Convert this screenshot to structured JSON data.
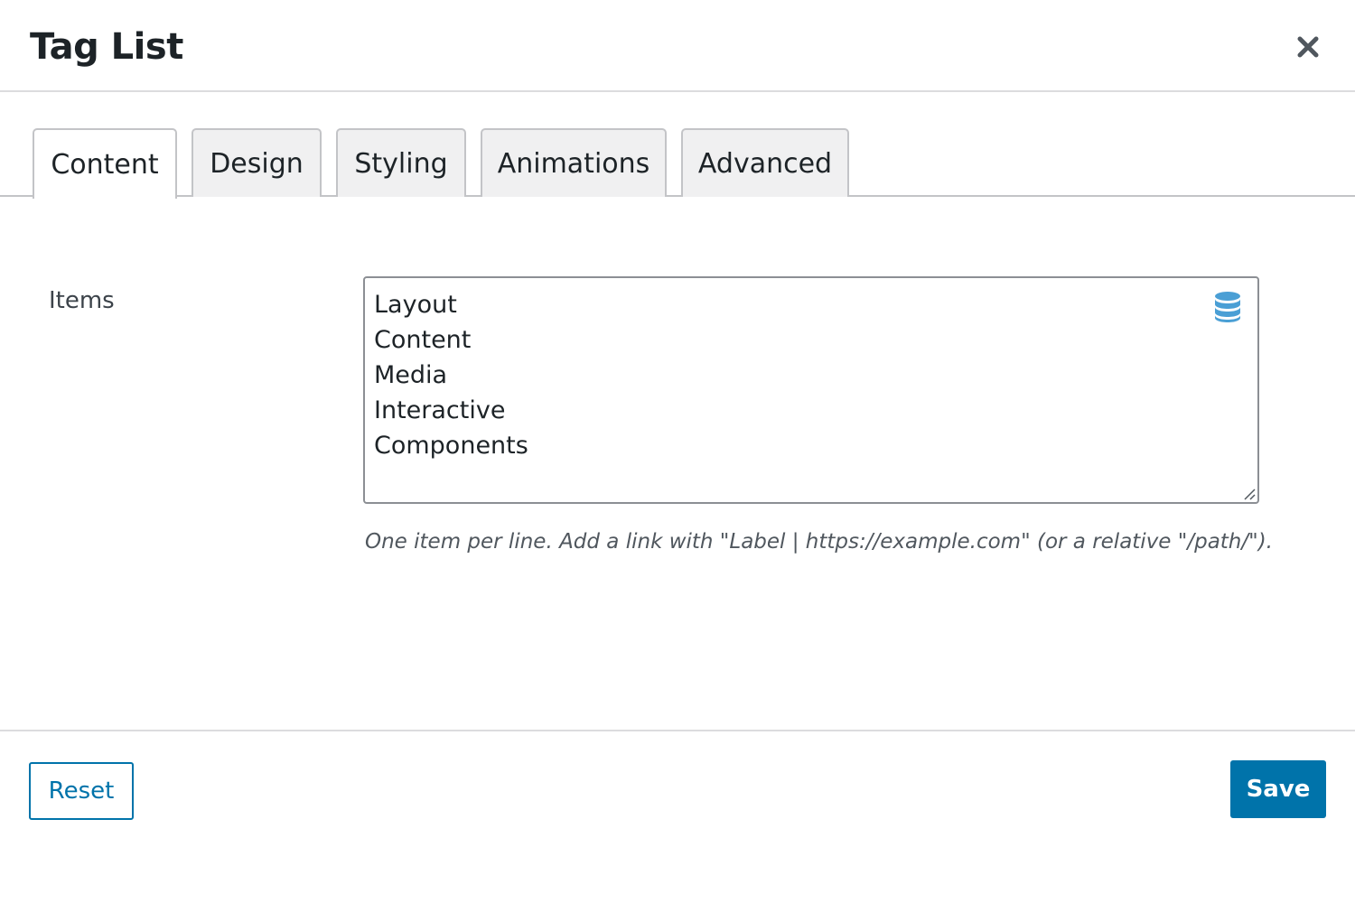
{
  "dialog": {
    "title": "Tag List",
    "close_icon": "close-icon"
  },
  "tabs": [
    {
      "label": "Content",
      "active": true
    },
    {
      "label": "Design",
      "active": false
    },
    {
      "label": "Styling",
      "active": false
    },
    {
      "label": "Animations",
      "active": false
    },
    {
      "label": "Advanced",
      "active": false
    }
  ],
  "content": {
    "items_label": "Items",
    "items_value": "Layout\nContent\nMedia\nInteractive\nComponents",
    "dynamic_data_icon": "database-icon",
    "help_text": "One item per line. Add a link with \"Label | https://example.com\" (or a relative \"/path/\")."
  },
  "footer": {
    "reset_label": "Reset",
    "save_label": "Save"
  },
  "colors": {
    "accent": "#0073aa",
    "icon_blue": "#4a9fd5",
    "tab_inactive_bg": "#f0f0f1",
    "border": "#c3c4c7"
  }
}
